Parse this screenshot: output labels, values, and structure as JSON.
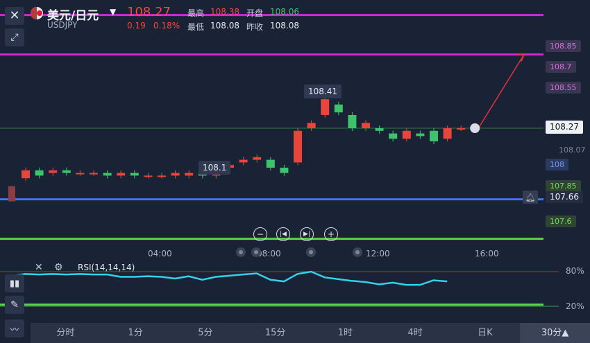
{
  "header": {
    "title": "美元/日元",
    "symbol": "USDJPY",
    "price": "108.27",
    "change": "0.19",
    "change_pct": "0.18%",
    "high_label": "最高",
    "high": "108.38",
    "open_label": "开盘",
    "open": "108.06",
    "low_label": "最低",
    "low": "108.08",
    "prev_label": "昨收",
    "prev": "108.08"
  },
  "levels": {
    "l1": "108.85",
    "l2": "108.7",
    "l3": "108.55",
    "current": "108.27",
    "grey": "108.07",
    "blue": "108",
    "green1": "107.85",
    "alert": "107.66",
    "green2": "107.6"
  },
  "callouts": {
    "peak": "108.41",
    "trough": "108.1"
  },
  "time_axis": [
    "04:00",
    "08:00",
    "12:00",
    "16:00"
  ],
  "rsi": {
    "label": "RSI(14,14,14)",
    "upper": "80%",
    "lower": "20%"
  },
  "timeframes": [
    "分时",
    "1分",
    "5分",
    "15分",
    "1时",
    "4时",
    "日K",
    "30分▲"
  ],
  "colors": {
    "up": "#e8463a",
    "down": "#3ec36a",
    "magenta": "#d026d6",
    "blue": "#3d7ae8",
    "green": "#5ad640",
    "rsi": "#31d3ea"
  },
  "chart_data": {
    "type": "candlestick",
    "series": [
      {
        "o": 108.08,
        "c": 108.11
      },
      {
        "o": 108.11,
        "c": 108.09
      },
      {
        "o": 108.1,
        "c": 108.11
      },
      {
        "o": 108.11,
        "c": 108.1
      },
      {
        "o": 108.1,
        "c": 108.1
      },
      {
        "o": 108.1,
        "c": 108.1
      },
      {
        "o": 108.1,
        "c": 108.09
      },
      {
        "o": 108.09,
        "c": 108.1
      },
      {
        "o": 108.1,
        "c": 108.09
      },
      {
        "o": 108.09,
        "c": 108.09
      },
      {
        "o": 108.09,
        "c": 108.09
      },
      {
        "o": 108.09,
        "c": 108.1
      },
      {
        "o": 108.09,
        "c": 108.1
      },
      {
        "o": 108.1,
        "c": 108.09
      },
      {
        "o": 108.09,
        "c": 108.11
      },
      {
        "o": 108.12,
        "c": 108.13
      },
      {
        "o": 108.14,
        "c": 108.15
      },
      {
        "o": 108.15,
        "c": 108.16
      },
      {
        "o": 108.15,
        "c": 108.12
      },
      {
        "o": 108.12,
        "c": 108.1
      },
      {
        "o": 108.14,
        "c": 108.26
      },
      {
        "o": 108.27,
        "c": 108.29
      },
      {
        "o": 108.32,
        "c": 108.38
      },
      {
        "o": 108.36,
        "c": 108.33
      },
      {
        "o": 108.32,
        "c": 108.27
      },
      {
        "o": 108.27,
        "c": 108.29
      },
      {
        "o": 108.27,
        "c": 108.26
      },
      {
        "o": 108.25,
        "c": 108.23
      },
      {
        "o": 108.23,
        "c": 108.26
      },
      {
        "o": 108.25,
        "c": 108.24
      },
      {
        "o": 108.26,
        "c": 108.22
      },
      {
        "o": 108.23,
        "c": 108.27
      },
      {
        "o": 108.27,
        "c": 108.27
      }
    ],
    "rsi": [
      73,
      76,
      75,
      76,
      75,
      76,
      75,
      75,
      71,
      71,
      72,
      71,
      68,
      72,
      66,
      71,
      73,
      75,
      77,
      66,
      63,
      76,
      80,
      70,
      67,
      64,
      62,
      58,
      61,
      57,
      57,
      65,
      63
    ]
  }
}
